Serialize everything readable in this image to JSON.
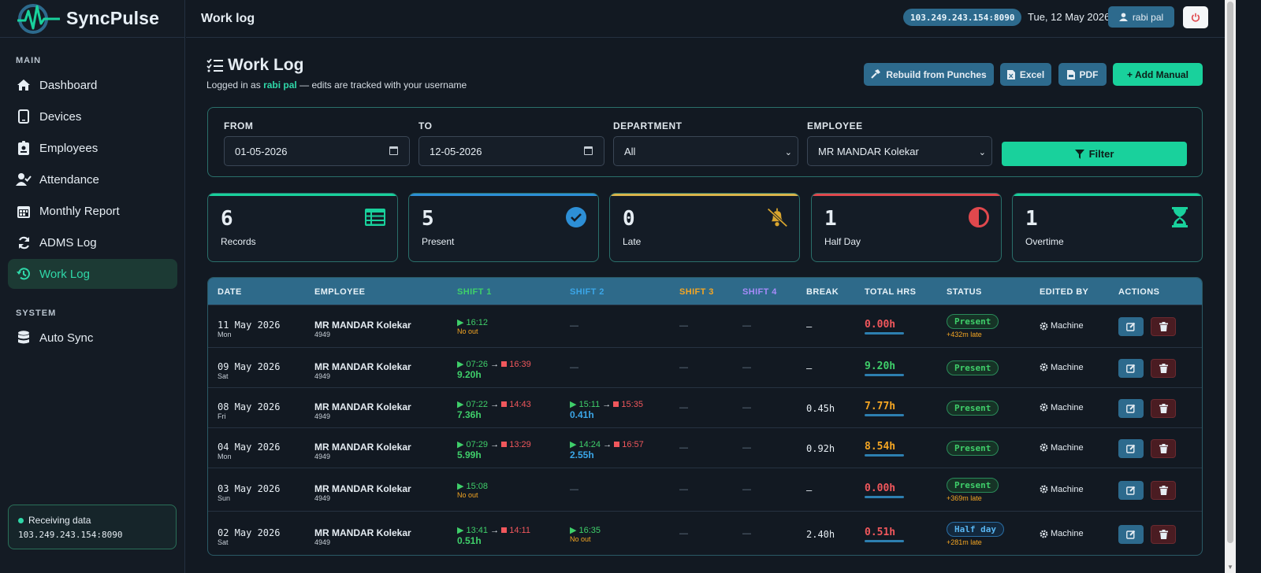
{
  "brand": {
    "name": "SyncPulse"
  },
  "topbar": {
    "title": "Work log",
    "ip": "103.249.243.154:8090",
    "date": "Tue, 12 May 2026",
    "user": "rabi pal"
  },
  "sidebar": {
    "sections": [
      {
        "label": "MAIN"
      },
      {
        "label": "SYSTEM"
      }
    ],
    "items": [
      {
        "label": "Dashboard",
        "icon": "home-icon"
      },
      {
        "label": "Devices",
        "icon": "device-icon"
      },
      {
        "label": "Employees",
        "icon": "id-badge-icon"
      },
      {
        "label": "Attendance",
        "icon": "user-check-icon"
      },
      {
        "label": "Monthly Report",
        "icon": "calendar-icon"
      },
      {
        "label": "ADMS Log",
        "icon": "sync-icon"
      },
      {
        "label": "Work Log",
        "icon": "history-icon",
        "active": true
      },
      {
        "label": "Auto Sync",
        "icon": "database-icon"
      }
    ],
    "status": {
      "label": "Receiving data",
      "ip": "103.249.243.154:8090"
    }
  },
  "page": {
    "title": "Work Log",
    "sub_prefix": "Logged in as",
    "sub_user": "rabi pal",
    "sub_suffix": "— edits are tracked with your username",
    "buttons": {
      "rebuild": "Rebuild from Punches",
      "excel": "Excel",
      "pdf": "PDF",
      "add": "+ Add Manual"
    }
  },
  "filter": {
    "from_label": "FROM",
    "from_value": "01-05-2026",
    "to_label": "TO",
    "to_value": "12-05-2026",
    "dept_label": "DEPARTMENT",
    "dept_value": "All",
    "emp_label": "EMPLOYEE",
    "emp_value": "MR MANDAR Kolekar",
    "button": "Filter"
  },
  "stats": [
    {
      "value": "6",
      "label": "Records",
      "color": "#19d19c",
      "icon": "table-list-icon"
    },
    {
      "value": "5",
      "label": "Present",
      "color": "#2d8fd6",
      "icon": "check-circle-icon"
    },
    {
      "value": "0",
      "label": "Late",
      "color": "#d9b44a",
      "icon": "bell-slash-icon"
    },
    {
      "value": "1",
      "label": "Half Day",
      "color": "#e0484d",
      "icon": "half-circle-icon"
    },
    {
      "value": "1",
      "label": "Overtime",
      "color": "#19d19c",
      "icon": "hourglass-icon"
    }
  ],
  "table": {
    "headers": {
      "date": "DATE",
      "employee": "EMPLOYEE",
      "shift1": "SHIFT 1",
      "shift2": "SHIFT 2",
      "shift3": "SHIFT 3",
      "shift4": "SHIFT 4",
      "break": "BREAK",
      "total": "TOTAL HRS",
      "status": "STATUS",
      "edited": "EDITED BY",
      "actions": "ACTIONS"
    },
    "header_colors": {
      "shift1": "#3fcf6a",
      "shift2": "#3ba6e8",
      "shift3": "#f5a623",
      "shift4": "#a78bfa"
    },
    "rows": [
      {
        "date": "11 May 2026",
        "day": "Mon",
        "emp": "MR MANDAR Kolekar",
        "id": "4949",
        "s1_in": "▶ 16:12",
        "s1_out": "",
        "s1_note": "No out",
        "s1_hrs": "",
        "s2_in": "",
        "s2_out": "",
        "s2_note": "",
        "s2_hrs": "",
        "s2_dash": "—",
        "s3": "—",
        "s4": "—",
        "brk": "—",
        "total": "0.00h",
        "total_color": "#f0575c",
        "status": "Present",
        "status_type": "present",
        "late": "+432m late",
        "edited": "Machine"
      },
      {
        "date": "09 May 2026",
        "day": "Sat",
        "emp": "MR MANDAR Kolekar",
        "id": "4949",
        "s1_in": "▶ 07:26",
        "s1_out": "16:39",
        "s1_note": "",
        "s1_hrs": "9.20h",
        "s2_in": "",
        "s2_out": "",
        "s2_note": "",
        "s2_hrs": "",
        "s2_dash": "—",
        "s3": "—",
        "s4": "—",
        "brk": "—",
        "total": "9.20h",
        "total_color": "#3fcf6a",
        "status": "Present",
        "status_type": "present",
        "late": "",
        "edited": "Machine"
      },
      {
        "date": "08 May 2026",
        "day": "Fri",
        "emp": "MR MANDAR Kolekar",
        "id": "4949",
        "s1_in": "▶ 07:22",
        "s1_out": "14:43",
        "s1_note": "",
        "s1_hrs": "7.36h",
        "s2_in": "▶ 15:11",
        "s2_out": "15:35",
        "s2_note": "",
        "s2_hrs": "0.41h",
        "s2_dash": "",
        "s3": "—",
        "s4": "—",
        "brk": "0.45h",
        "total": "7.77h",
        "total_color": "#f5a623",
        "status": "Present",
        "status_type": "present",
        "late": "",
        "edited": "Machine"
      },
      {
        "date": "04 May 2026",
        "day": "Mon",
        "emp": "MR MANDAR Kolekar",
        "id": "4949",
        "s1_in": "▶ 07:29",
        "s1_out": "13:29",
        "s1_note": "",
        "s1_hrs": "5.99h",
        "s2_in": "▶ 14:24",
        "s2_out": "16:57",
        "s2_note": "",
        "s2_hrs": "2.55h",
        "s2_dash": "",
        "s3": "—",
        "s4": "—",
        "brk": "0.92h",
        "total": "8.54h",
        "total_color": "#f5a623",
        "status": "Present",
        "status_type": "present",
        "late": "",
        "edited": "Machine"
      },
      {
        "date": "03 May 2026",
        "day": "Sun",
        "emp": "MR MANDAR Kolekar",
        "id": "4949",
        "s1_in": "▶ 15:08",
        "s1_out": "",
        "s1_note": "No out",
        "s1_hrs": "",
        "s2_in": "",
        "s2_out": "",
        "s2_note": "",
        "s2_hrs": "",
        "s2_dash": "—",
        "s3": "—",
        "s4": "—",
        "brk": "—",
        "total": "0.00h",
        "total_color": "#f0575c",
        "status": "Present",
        "status_type": "present",
        "late": "+369m late",
        "edited": "Machine"
      },
      {
        "date": "02 May 2026",
        "day": "Sat",
        "emp": "MR MANDAR Kolekar",
        "id": "4949",
        "s1_in": "▶ 13:41",
        "s1_out": "14:11",
        "s1_note": "",
        "s1_hrs": "0.51h",
        "s2_in": "▶ 16:35",
        "s2_out": "",
        "s2_note": "No out",
        "s2_hrs": "",
        "s2_dash": "",
        "s3": "—",
        "s4": "—",
        "brk": "2.40h",
        "total": "0.51h",
        "total_color": "#f0575c",
        "status": "Half day",
        "status_type": "half",
        "late": "+281m late",
        "edited": "Machine"
      }
    ]
  }
}
